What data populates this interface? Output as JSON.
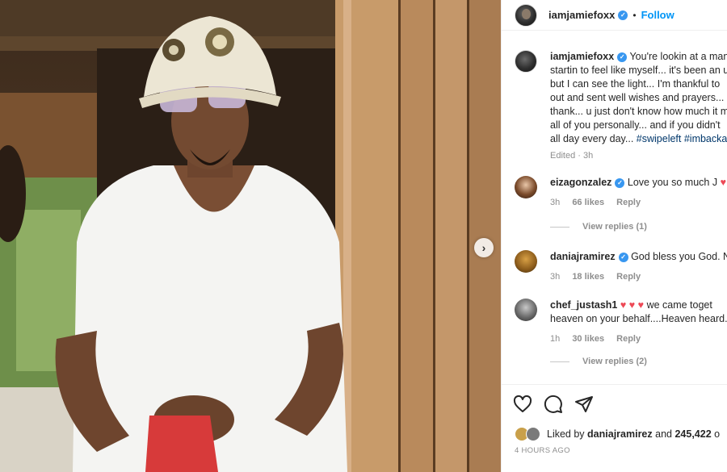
{
  "post": {
    "username": "iamjamiefoxx",
    "follow_label": "Follow",
    "dot": "•",
    "caption": {
      "lines": [
        "You're lookin at a man",
        "startin to feel like myself... it's been an u",
        "but I can see the light... I'm thankful to",
        "out and sent well wishes and prayers...",
        "thank... u just don't know how much it m",
        "all of you personally... and if you didn't",
        "all day every day..."
      ],
      "hashtags": "#swipeleft #imbacka",
      "edited": "Edited · 3h"
    }
  },
  "comments": [
    {
      "user": "eizagonzalez",
      "text": "Love you so much J",
      "time": "3h",
      "likes": "66 likes",
      "reply": "Reply",
      "view_replies": "View replies (1)",
      "verified": true
    },
    {
      "user": "daniajramirez",
      "text": "God bless you God. N",
      "time": "3h",
      "likes": "18 likes",
      "reply": "Reply",
      "verified": true
    },
    {
      "user": "chef_justash1",
      "text_line1": "we came toget",
      "text_line2": "heaven on your behalf....Heaven heard.",
      "time": "1h",
      "likes": "30 likes",
      "reply": "Reply",
      "view_replies": "View replies (2)"
    }
  ],
  "footer": {
    "liked_prefix": "Liked by",
    "liked_user": "daniajramirez",
    "liked_and": "and",
    "liked_count": "245,422",
    "liked_suffix": "o",
    "time_ago": "4 HOURS AGO"
  },
  "icons": {
    "heart": "heart-icon",
    "comment": "comment-icon",
    "share": "share-icon",
    "next": "chevron-right-icon",
    "verified": "verified-badge-icon"
  },
  "colors": {
    "link": "#0095f6",
    "verified": "#3897f0",
    "heart": "#ed4956",
    "muted": "#8e8e8e"
  }
}
